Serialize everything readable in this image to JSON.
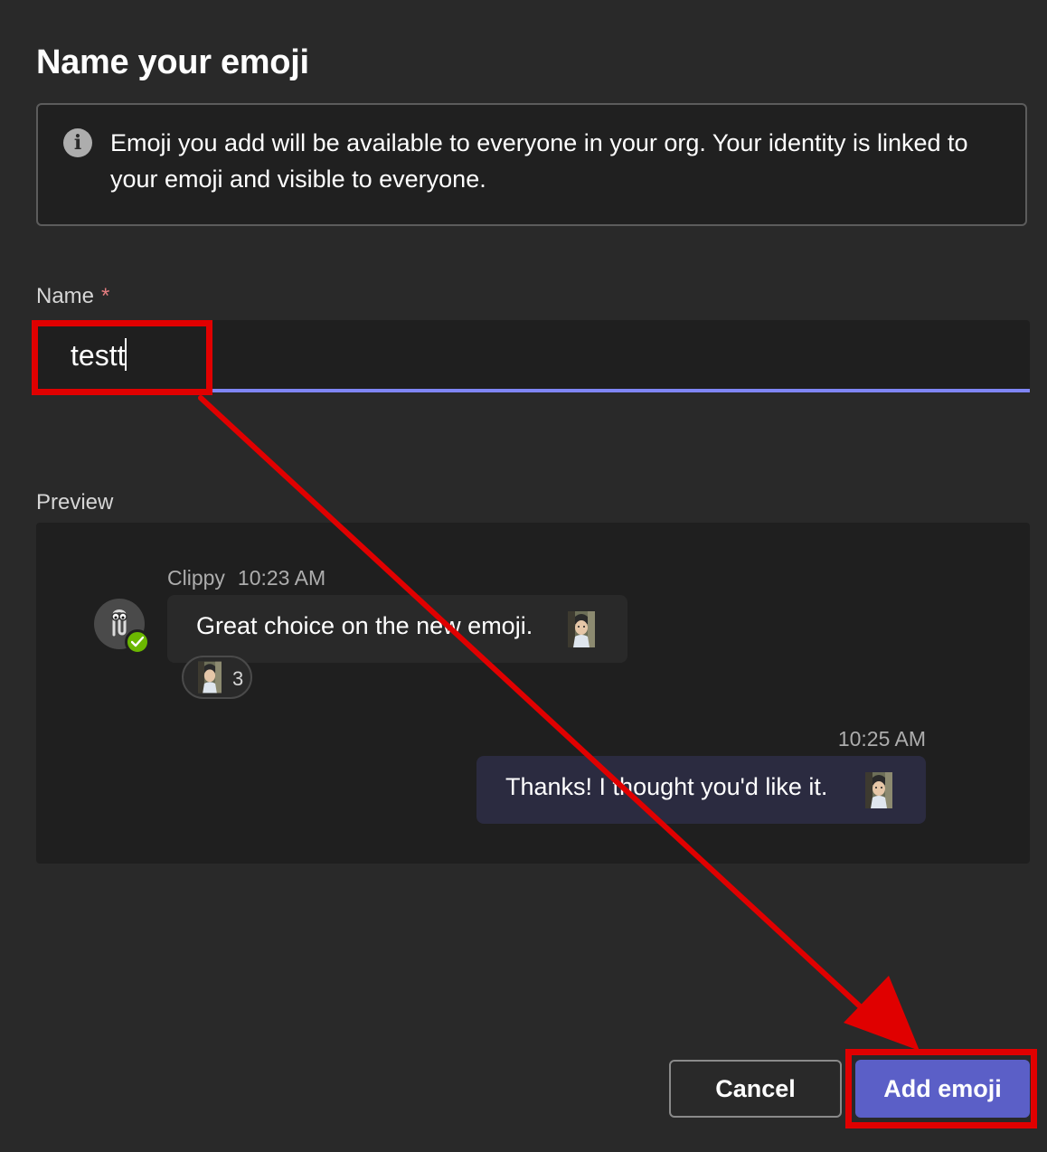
{
  "dialog": {
    "title": "Name your emoji",
    "info_text": "Emoji you add will be available to everyone in your org. Your identity is linked to your emoji and visible to everyone.",
    "info_icon": "info-icon"
  },
  "name_field": {
    "label": "Name",
    "required_mark": "*",
    "value": "testt"
  },
  "preview": {
    "label": "Preview",
    "incoming": {
      "sender": "Clippy",
      "time": "10:23 AM",
      "text": "Great choice on the new emoji.",
      "reaction_count": "3"
    },
    "outgoing": {
      "time": "10:25 AM",
      "text": "Thanks! I thought you'd like it."
    }
  },
  "buttons": {
    "cancel": "Cancel",
    "add": "Add emoji"
  },
  "colors": {
    "background": "#292929",
    "accent": "#5b5fc7",
    "input_underline": "#7f85f5",
    "annotation": "#e00000",
    "presence": "#6bb700"
  }
}
